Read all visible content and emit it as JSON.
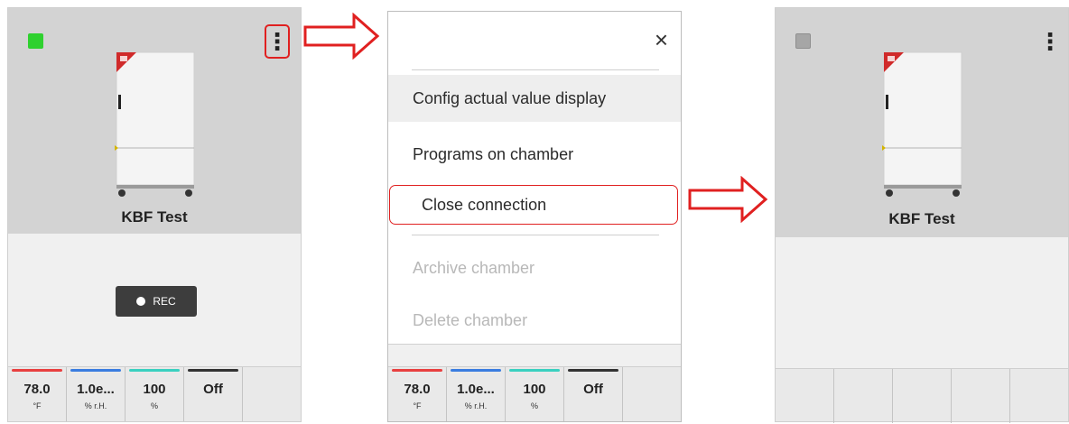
{
  "colors": {
    "status_connected": "#2fd12f",
    "status_disconnected": "#a6a6a6",
    "highlight_red": "#e02020",
    "temp_bar": "#e84040",
    "humidity_bar": "#3a7de0",
    "fan_bar": "#3ad0c0",
    "off_bar": "#333333"
  },
  "chamber": {
    "name": "KBF Test",
    "rec_label": "REC"
  },
  "readouts": [
    {
      "value": "78.0",
      "unit": "°F"
    },
    {
      "value": "1.0e...",
      "unit": "% r.H."
    },
    {
      "value": "100",
      "unit": "%"
    },
    {
      "value": "Off",
      "unit": ""
    }
  ],
  "menu": {
    "close_icon": "×",
    "items": [
      {
        "label": "Config actual value display",
        "enabled": true
      },
      {
        "label": "Programs on chamber",
        "enabled": true
      },
      {
        "label": "Close connection",
        "enabled": true
      },
      {
        "label": "Archive chamber",
        "enabled": false
      },
      {
        "label": "Delete chamber",
        "enabled": false
      }
    ]
  },
  "icons": {
    "kebab": "⋮"
  }
}
